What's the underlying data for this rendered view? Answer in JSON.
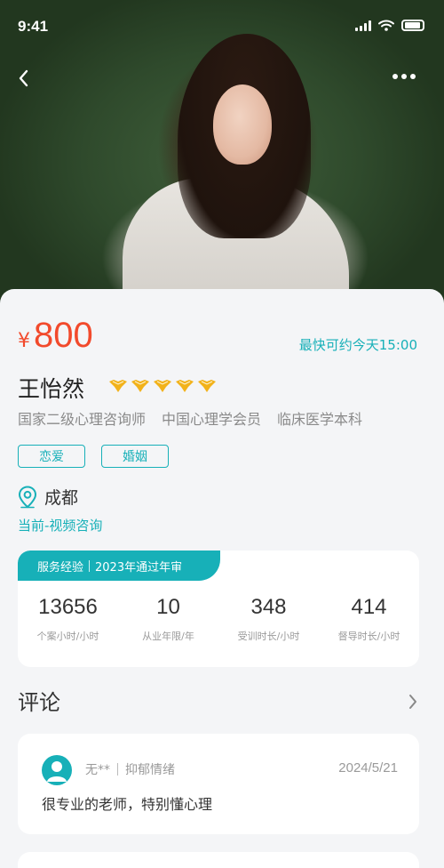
{
  "status": {
    "time": "9:41"
  },
  "profile": {
    "currency": "¥",
    "price": "800",
    "earliest": "最快可约今天15:00",
    "name": "王怡然",
    "rating_stars": 5,
    "credentials": [
      "国家二级心理咨询师",
      "中国心理学会员",
      "临床医学本科"
    ],
    "topics": [
      "恋爱",
      "婚姻"
    ],
    "city": "成都",
    "mode": "当前-视频咨询"
  },
  "stats": {
    "ribbon_left": "服务经验",
    "ribbon_right": "2023年通过年审",
    "items": [
      {
        "value": "13656",
        "label": "个案小时/小时"
      },
      {
        "value": "10",
        "label": "从业年限/年"
      },
      {
        "value": "348",
        "label": "受训时长/小时"
      },
      {
        "value": "414",
        "label": "督导时长/小时"
      }
    ]
  },
  "comments": {
    "title": "评论",
    "items": [
      {
        "user": "无**",
        "tag": "抑郁情绪",
        "date": "2024/5/21",
        "text": "很专业的老师，特别懂心理"
      }
    ]
  },
  "colors": {
    "accent": "#17b0b8",
    "price": "#f24a2c",
    "star": "#f2b21a"
  }
}
